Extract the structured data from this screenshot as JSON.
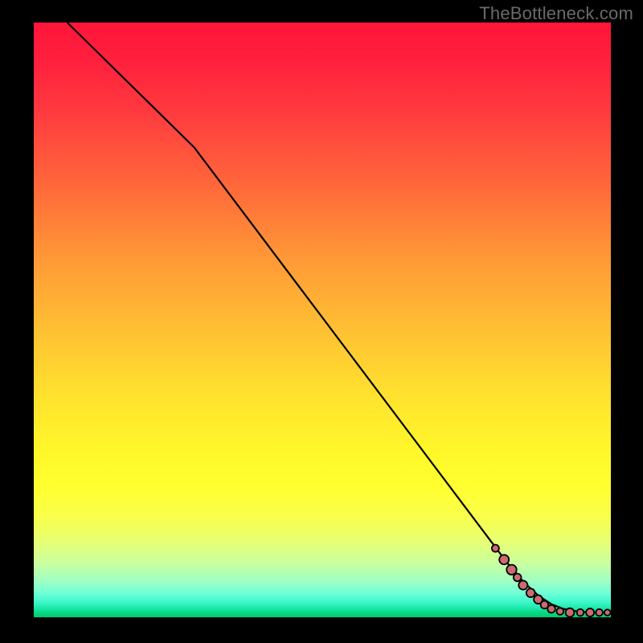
{
  "watermark": "TheBottleneck.com",
  "chart_data": {
    "type": "line",
    "title": "",
    "xlabel": "",
    "ylabel": "",
    "xlim": [
      0,
      100
    ],
    "ylim": [
      0,
      100
    ],
    "black_line": [
      {
        "x": 5.8,
        "y": 100.0
      },
      {
        "x": 27.8,
        "y": 79.0
      },
      {
        "x": 82.0,
        "y": 9.2
      },
      {
        "x": 85.0,
        "y": 5.8
      },
      {
        "x": 87.5,
        "y": 3.6
      },
      {
        "x": 89.7,
        "y": 2.2
      },
      {
        "x": 91.8,
        "y": 1.4
      },
      {
        "x": 94.0,
        "y": 1.0
      },
      {
        "x": 96.5,
        "y": 0.8
      },
      {
        "x": 100.0,
        "y": 0.8
      }
    ],
    "marker_series": {
      "name": "markers",
      "color": "#cc6a6e",
      "points": [
        {
          "x": 80.0,
          "y": 11.6,
          "r": 4.5
        },
        {
          "x": 81.5,
          "y": 9.7,
          "r": 6.0
        },
        {
          "x": 82.8,
          "y": 8.0,
          "r": 6.2
        },
        {
          "x": 83.8,
          "y": 6.7,
          "r": 4.8
        },
        {
          "x": 84.8,
          "y": 5.4,
          "r": 5.6
        },
        {
          "x": 86.1,
          "y": 4.1,
          "r": 5.4
        },
        {
          "x": 87.4,
          "y": 3.0,
          "r": 5.4
        },
        {
          "x": 88.5,
          "y": 2.1,
          "r": 4.8
        },
        {
          "x": 89.7,
          "y": 1.4,
          "r": 4.8
        },
        {
          "x": 91.2,
          "y": 1.0,
          "r": 4.3
        },
        {
          "x": 92.9,
          "y": 0.8,
          "r": 5.4
        },
        {
          "x": 94.7,
          "y": 0.8,
          "r": 4.3
        },
        {
          "x": 96.4,
          "y": 0.8,
          "r": 5.0
        },
        {
          "x": 98.0,
          "y": 0.8,
          "r": 4.3
        },
        {
          "x": 99.4,
          "y": 0.8,
          "r": 3.8
        }
      ]
    }
  }
}
